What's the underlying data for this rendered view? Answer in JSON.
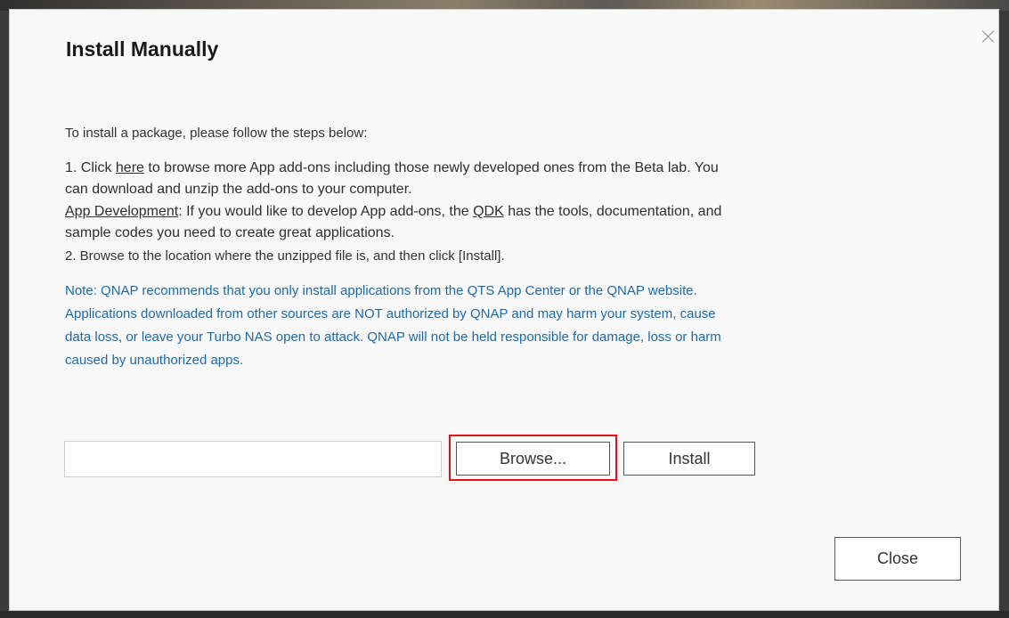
{
  "dialog": {
    "title": "Install Manually",
    "intro": "To install a package, please follow the steps below:",
    "step1": {
      "prefix": "1. Click ",
      "link": "here",
      "suffix": " to browse more App add-ons including those newly developed ones from the Beta lab. You",
      "line2": "can download and unzip the add-ons to your computer."
    },
    "dev": {
      "link": "App Development",
      "mid": ": If you would like to develop App add-ons, the ",
      "qdk": "QDK",
      "suffix": " has the tools, documentation, and",
      "line2": "sample codes you need to create great applications."
    },
    "step2": "2. Browse to the location where the unzipped file is, and then click [Install].",
    "note": {
      "label": "Note",
      "line1": ": QNAP recommends that you only install applications from the QTS App Center or the QNAP website.",
      "line2": "Applications downloaded from other sources are NOT authorized by QNAP and may harm your system, cause",
      "line3": "data loss, or leave your Turbo NAS open to attack. QNAP will not be held responsible for damage, loss or harm",
      "line4": "caused by unauthorized apps."
    },
    "file_input": {
      "value": "",
      "placeholder": ""
    },
    "browse_label": "Browse...",
    "install_label": "Install",
    "close_label": "Close"
  },
  "colors": {
    "note_blue": "#1e6aa8",
    "highlight_red": "#e0121a"
  }
}
